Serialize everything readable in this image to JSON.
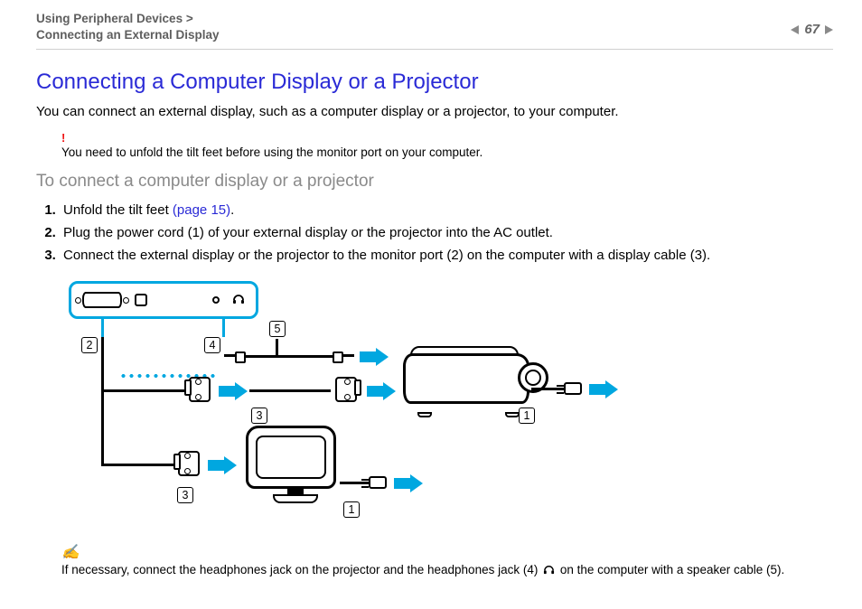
{
  "header": {
    "breadcrumb_line1": "Using Peripheral Devices >",
    "breadcrumb_line2": "Connecting an External Display",
    "page_number": "67"
  },
  "title": "Connecting a Computer Display or a Projector",
  "intro": "You can connect an external display, such as a computer display or a projector, to your computer.",
  "warning": {
    "mark": "!",
    "text": "You need to unfold the tilt feet before using the monitor port on your computer."
  },
  "subhead": "To connect a computer display or a projector",
  "steps": {
    "s1_pre": "Unfold the tilt feet ",
    "s1_link": "(page 15)",
    "s1_post": ".",
    "s2": "Plug the power cord (1) of your external display or the projector into the AC outlet.",
    "s3": "Connect the external display or the projector to the monitor port (2) on the computer with a display cable (3)."
  },
  "diagram_labels": {
    "l1": "1",
    "l2": "2",
    "l3": "3",
    "l4": "4",
    "l5": "5"
  },
  "footnote": {
    "mark": "✍",
    "pre": "If necessary, connect the headphones jack on the projector and the headphones jack (4) ",
    "icon_name": "headphones-icon",
    "post": " on the computer with a speaker cable (5)."
  }
}
